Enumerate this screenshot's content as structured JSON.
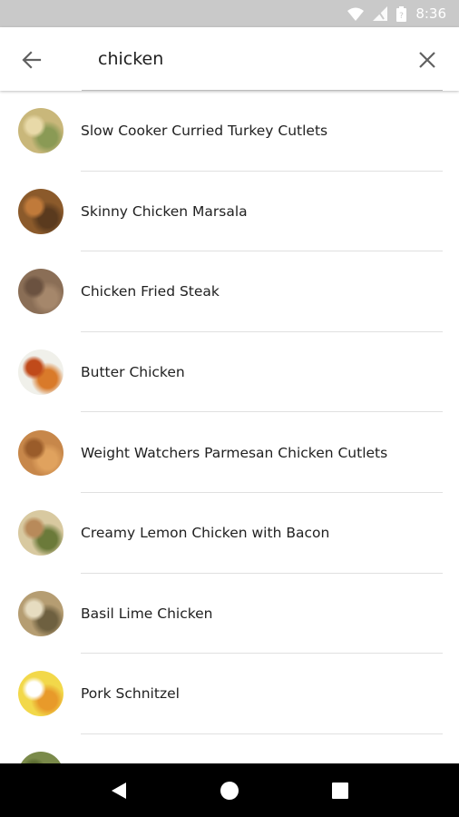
{
  "status_bar": {
    "time": "8:36",
    "icons": [
      "wifi-icon",
      "signal-icon",
      "battery-icon"
    ]
  },
  "search": {
    "query": "chicken",
    "back_icon": "arrow-back-icon",
    "clear_icon": "close-icon"
  },
  "results": [
    {
      "title": "Slow Cooker Curried Turkey Cutlets",
      "thumb_colors": [
        "#c9b77a",
        "#8a9a55",
        "#e8d9a8"
      ]
    },
    {
      "title": "Skinny Chicken Marsala",
      "thumb_colors": [
        "#8b5a2b",
        "#5a3a1e",
        "#c07a3a"
      ]
    },
    {
      "title": "Chicken Fried Steak",
      "thumb_colors": [
        "#8a6e56",
        "#a5876b",
        "#6b5240"
      ]
    },
    {
      "title": "Butter Chicken",
      "thumb_colors": [
        "#f0f0ea",
        "#d97a2a",
        "#c04a1a"
      ]
    },
    {
      "title": "Weight Watchers Parmesan Chicken Cutlets",
      "thumb_colors": [
        "#c7874a",
        "#e0a25e",
        "#9a5c2a"
      ]
    },
    {
      "title": "Creamy Lemon Chicken with Bacon",
      "thumb_colors": [
        "#d8c9a0",
        "#6b7a3a",
        "#b88a5a"
      ]
    },
    {
      "title": "Basil Lime Chicken",
      "thumb_colors": [
        "#b59d72",
        "#6e6040",
        "#e6dcc0"
      ]
    },
    {
      "title": "Pork Schnitzel",
      "thumb_colors": [
        "#f2d84a",
        "#e89a2a",
        "#ffffff"
      ]
    },
    {
      "title": "",
      "thumb_colors": [
        "#7a8a4a",
        "#c9b77a",
        "#5a6a30"
      ]
    }
  ],
  "nav": {
    "back_icon": "nav-back-icon",
    "home_icon": "nav-home-icon",
    "recents_icon": "nav-recents-icon"
  }
}
